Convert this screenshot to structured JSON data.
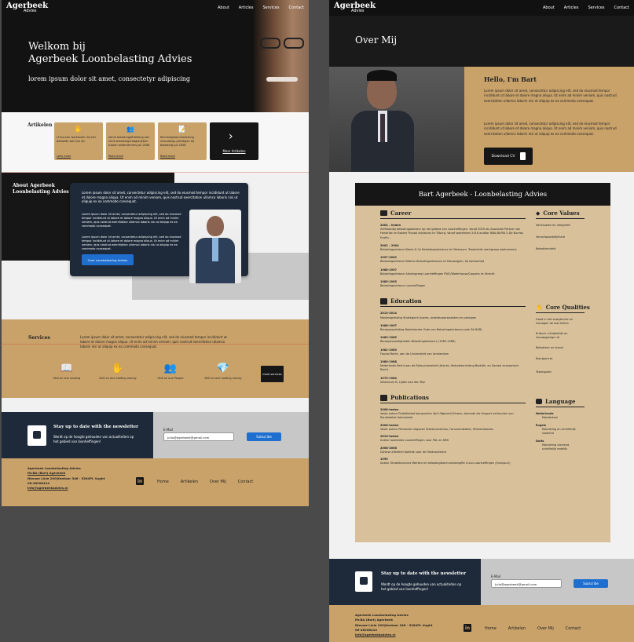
{
  "brand": {
    "name": "Agerbeek",
    "sub": "Advies"
  },
  "nav": [
    "About",
    "Articles",
    "Services",
    "Contact"
  ],
  "hero": {
    "title_line1": "Welkom bij",
    "title_line2": "Agerbeek Loonbelasting Advies",
    "subtitle": "lorem ipsum dolor sit amet, consectetyr adipiscing"
  },
  "articles": {
    "heading": "Artikelen",
    "cards": [
      {
        "text": "Lf kunnen werkenden bij het betaalde wel hun lijn",
        "link": "Lees meer"
      },
      {
        "text": "Vanaf belastingaftrekking aan recht belastingvraagstukken tussen ondernemers Juli 2008",
        "link": "Read more"
      },
      {
        "text": "Rechtsbijstand belasting inhoudings-plichtigen bij belasting Juli 2008",
        "link": "Read more"
      }
    ],
    "more": "Meer Artikelen"
  },
  "about": {
    "heading_line1": "About Agerbeek",
    "heading_line2": "Loonbelasting Advies",
    "p1": "Lorem ipsum dolor sit amet, consectetur adipiscing elit, sed do eiusmod tempor incididunt ut labore et dolore magna aliqua. Ut enim ad minim veniam, quis nostrud exercitation ullamco laboris nisi ut aliquip ex ea commodo consequat.",
    "p2": "Lorem ipsum dolor sit amet, consectetur adipiscing elit, sed do eiusmod tempor incididunt ut labore et dolore magna aliqua. Ut enim ad minim veniam, quis nostrud exercitation ullamco laboris nisi ut aliquip ex ea commodo consequat.",
    "p3": "Lorem ipsum dolor sit amet, consectetur adipiscing elit, sed do eiusmod tempor incididunt ut labore et dolore magna aliqua. Ut enim ad minim veniam, quis nostrud exercitation ullamco laboris nisi ut aliquip ex ea commodo consequat.",
    "button": "Over Loonbelasting Advies"
  },
  "services": {
    "heading": "Services",
    "text": "Lorem ipsum dolor sit amet, consectetur adipiscing elit, sed do eiusmod tempor incididunt ut labore et dolore magna aliqua. Ut enim ad minim veniam, quis nostrud exercitation ullamco laboris nisi ut aliquip ex ea commodo consequat.",
    "items": [
      {
        "icon": "book-icon",
        "label": "Skill on one reading"
      },
      {
        "icon": "hand-coin-icon",
        "label": "Skill on one holding money"
      },
      {
        "icon": "people-icon",
        "label": "Skill on one People"
      },
      {
        "icon": "diamond-icon",
        "label": "Skill on one holding money"
      }
    ],
    "more": "more services"
  },
  "newsletter": {
    "title": "Stay up to date with the newsletter",
    "text": "Wordt op de hoogte gehouden van actualiteiten op het gebied van loonheffingen!",
    "email_label": "E-Mail",
    "email_value": "Julio@agerbeek@gmail.com",
    "email_value_right": "Julio@agerbeek@gmail.com",
    "button": "Subscribe"
  },
  "footer": {
    "company": "Agerbeek Loonbelasting Advies",
    "person": "Mr.BA (Bart) Agerbeek",
    "address": "Nieuwe Linie 200|Kentoor 346 - 5264PL Vught",
    "phone": "06-46208414",
    "email": "info@agerbeekadvies.nl",
    "links": [
      "Home",
      "Artikelen",
      "Over Mij",
      "Contact"
    ]
  },
  "over": {
    "title": "Over Mij",
    "hello": "Hello, I'm Bart",
    "p1": "Lorem ipsum dolor sit amet, consectetur adipiscing elit, sed do eiusmod tempor incididunt ut labore et dolore magna aliqua. Ut enim ad minim veniam, quis nostrud exercitation ullamco laboris nisi ut aliquip ex ea commodo consequat.",
    "p2": "Lorem ipsum dolor sit amet, consectetur adipiscing elit, sed do eiusmod tempor incididunt ut labore et dolore magna aliqua. Ut enim ad minim veniam, quis nostrud exercitation ullamco laboris nisi ut aliquip ex ea commodo consequat.",
    "cv_button": "Download CV"
  },
  "cv": {
    "title": "Bart Agerbeek - Loonbelasting Advies",
    "career_heading": "Career",
    "career": [
      {
        "year": "2004 – heden",
        "text": "Zelfstandig belastingadviseur op het gebied van Loonheffingen. Vanaf 2009 als Associate Partner van Hendrike en Bakker Fiscaal adviseurs te Tilburg. Vanaf september 2016 auditor NBA-NIVRA 5 De Bureau Ecofin."
      },
      {
        "year": "2002 – 2004",
        "text": "Belastingadviseur Bierie & Co Belastingadviseurs te Hilversum. Teamleider werkgroep werknemers"
      },
      {
        "year": "1997-2002",
        "text": "Belastingadviseur Bldmer Belastingadviseurs te Nieuwegein, bij kantoortijd"
      },
      {
        "year": "1988-1997",
        "text": "Belastingadviseur Adviesgroep Loonheffingen PWC/Waterhouse/Coopers te Utrecht"
      },
      {
        "year": "1985-1995",
        "text": "Belastingadviseur Loonheffingen"
      }
    ],
    "education_heading": "Education",
    "education": [
      {
        "year": "2013-2014",
        "text": "Masteropleiding Strategisch Advies, arbeidsvoorwaarden en pensioen"
      },
      {
        "year": "1986-1997",
        "text": "Beroepsopleiding Nederlandse Orde van Belastingadviseurs (ook 3d NOB)"
      },
      {
        "year": "1983-1985",
        "text": "Beroepsvaardigheden Belastingadviseurs (1983-1986)"
      },
      {
        "year": "1981-1983",
        "text": "Fiscaal Recht, aan de Universiteit van Amsterdam"
      },
      {
        "year": "1980-1988",
        "text": "Nederlands Recht aan de Rijksuniversiteit Utrecht, Afstudeerrichting Bedrijfs- en Sociaal economisch Recht"
      },
      {
        "year": "1979-1984",
        "text": "Atheneum B, Lijden aan den Rijn"
      }
    ],
    "publications_heading": "Publications",
    "publications": [
      {
        "year": "2008-heden",
        "text": "Vaste auteur Praktijkblad loonsoorten lijst Uitgeverij Kluwer, alsmede als Huspart verhouden van Rondedekst Adviesdesk"
      },
      {
        "year": "2006-heden",
        "text": "Vaste auteur Personeel-uitgaven Stekelcondensa, Focusmededeel, HRmeedeavies"
      },
      {
        "year": "2010-heden",
        "text": "Auteur loonbrede Loonheffingen voor FDL en NRS"
      },
      {
        "year": "2008-2006",
        "text": "Diverse artikelen Koeltak voor de Holdvadviseur"
      },
      {
        "year": "1995",
        "text": "Auteur Studiebrochure Werken en belastingbrochure/aangifte Curus Loonheffingen (Europa.nl)"
      }
    ],
    "values_heading": "Core Values",
    "values": [
      "Vertrouwen en integriteit",
      "Verantwoordelijkheid",
      "Betrokkenheid"
    ],
    "qualities_heading": "Core Qualities",
    "qualities": [
      "Goed in het analytische en managen de taal heiten",
      "Kritisch, initiatiefrijk en nieuwsgierige uit",
      "Betrokken en loyaal",
      "Klantgericht",
      "Teamspeler"
    ],
    "language_heading": "Language",
    "languages": [
      {
        "name": "Nederlands",
        "level": "Moedertaal"
      },
      {
        "name": "Engels",
        "level": "Mondeling en schriftelijk vloeiend"
      },
      {
        "name": "Duits",
        "level": "Mondeling vloeiend, schriftelijk redelijk"
      }
    ]
  },
  "colors": {
    "gold": "#c9a26a",
    "dark": "#161616",
    "navy": "#1e2a3a",
    "blue": "#1f6fd1",
    "beige": "#d8c19a"
  }
}
